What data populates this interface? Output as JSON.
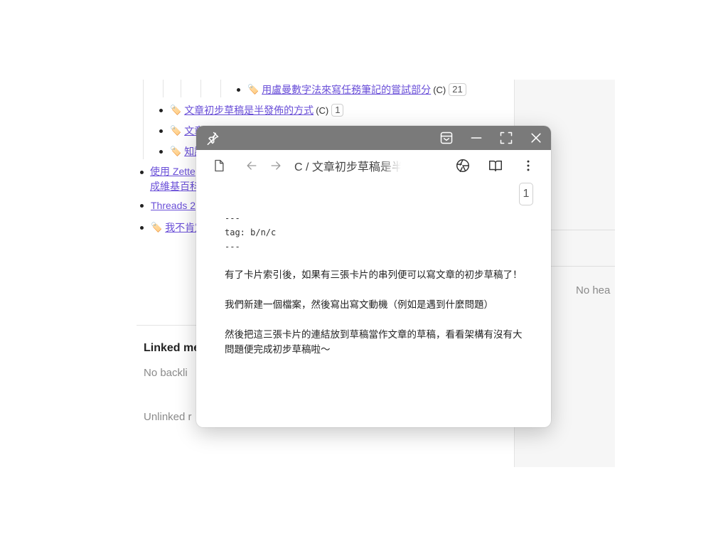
{
  "note": {
    "list": [
      {
        "title": "用盧曼數字法來寫任務筆記的嘗試部分",
        "suffix": "(C)",
        "count": "21"
      },
      {
        "title": "文章初步草稿是半發佈的方式",
        "suffix": "(C)",
        "count": "1"
      },
      {
        "title": "文章"
      },
      {
        "title": "知識"
      }
    ],
    "item_zettel_line1": "使用 Zette",
    "item_zettel_line2": "成維基百科",
    "item_threads": "Threads 2",
    "item_unsure": "我不肯定",
    "linked_mentions": "Linked me",
    "no_backlinks": "No backli",
    "unlinked_mentions": "Unlinked r"
  },
  "right_pane": {
    "no_headings": "No hea"
  },
  "popup": {
    "breadcrumb": "C / 文章初步草稿是半發佈的方式",
    "backlink_count": "1",
    "frontmatter": [
      "---",
      "tag: b/n/c",
      "---"
    ],
    "paragraphs": [
      "有了卡片索引後，如果有三張卡片的串列便可以寫文章的初步草稿了！",
      "我們新建一個檔案，然後寫出寫文動機（例如是遇到什麼問題）",
      "然後把這三張卡片的連結放到草稿當作文章的草稿，看看架構有沒有大問題便完成初步草稿啦～"
    ]
  },
  "colors": {
    "link": "#6a4fd8",
    "titlebar": "#7a7a7a",
    "muted_text": "#8a8a8a"
  }
}
